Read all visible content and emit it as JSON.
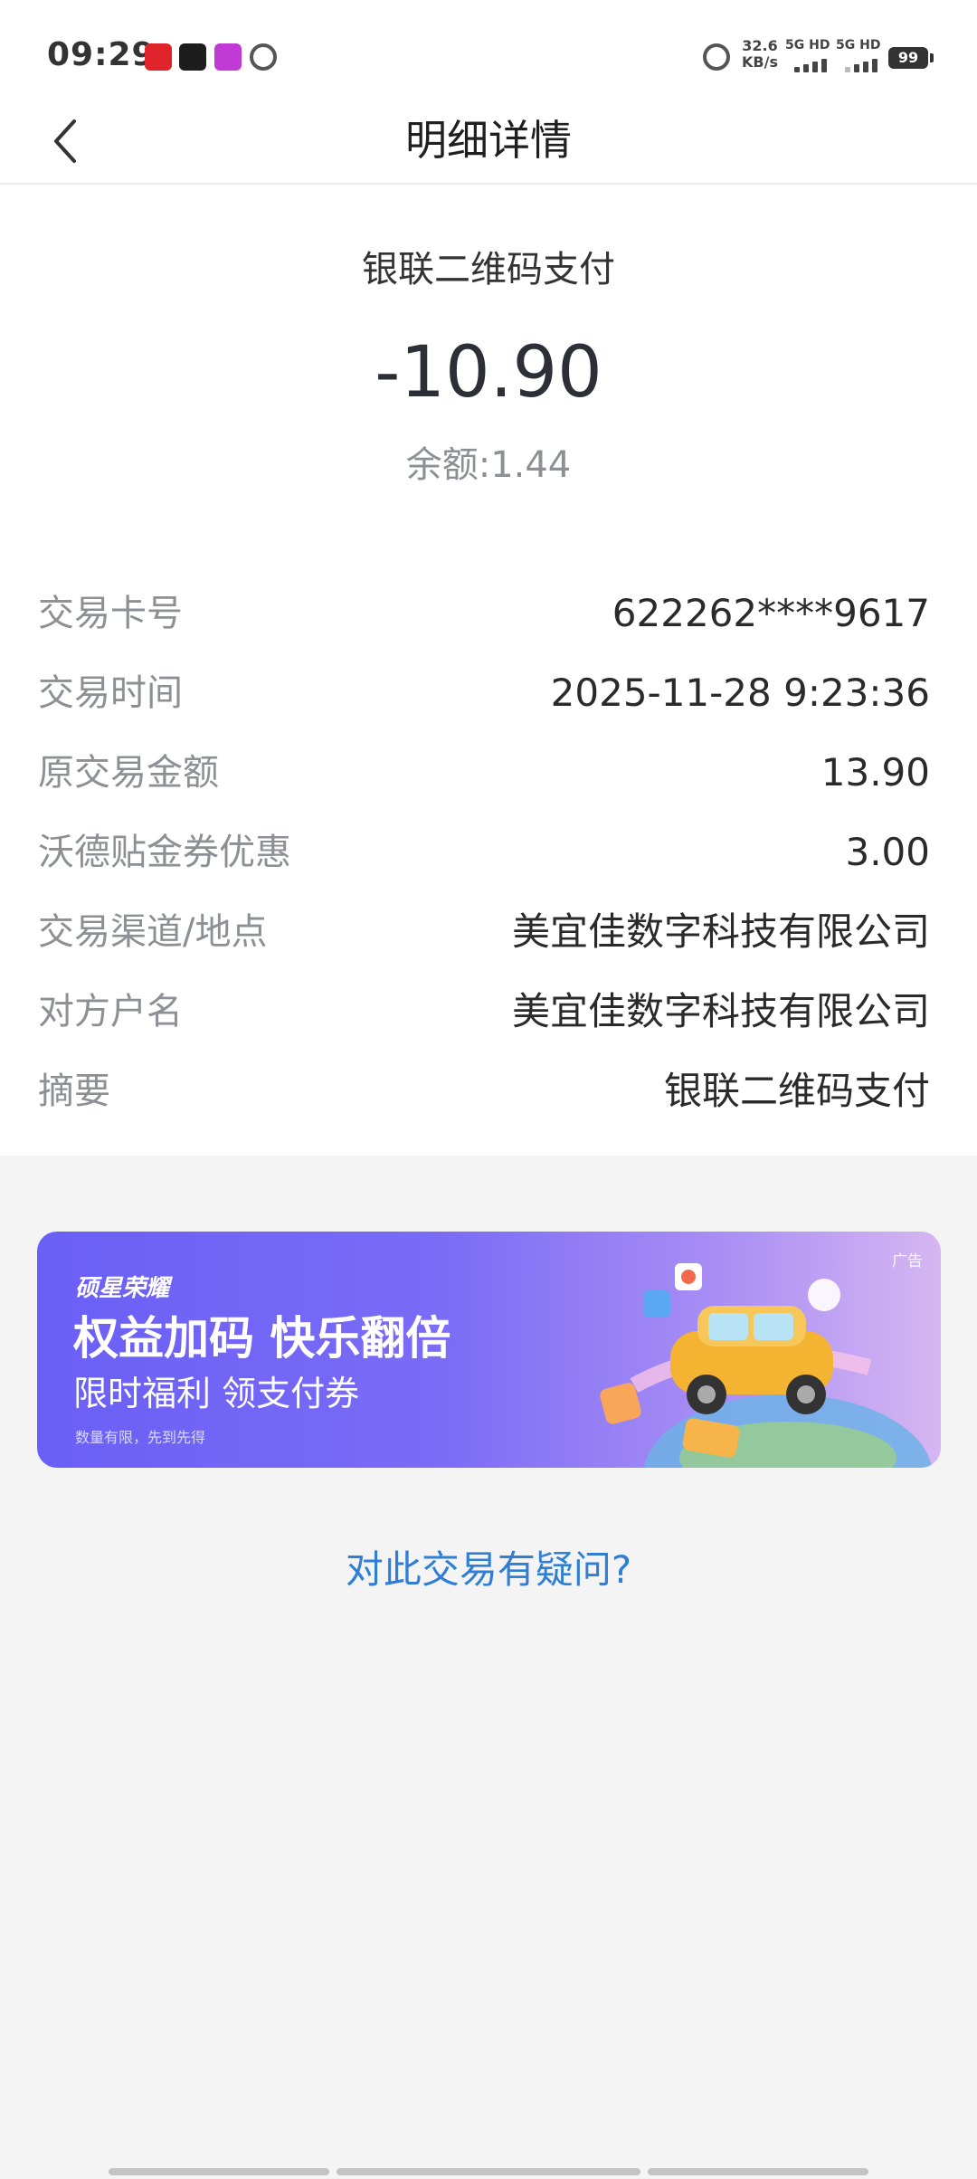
{
  "status_bar": {
    "time": "09:29",
    "net_speed_value": "32.6",
    "net_speed_unit": "KB/s",
    "signal1_label": "5G HD",
    "signal2_label": "5G HD",
    "battery": "99"
  },
  "nav": {
    "title": "明细详情"
  },
  "summary": {
    "type": "银联二维码支付",
    "amount": "-10.90",
    "balance": "余额:1.44"
  },
  "details": [
    {
      "label": "交易卡号",
      "value": "622262****9617"
    },
    {
      "label": "交易时间",
      "value": "2025-11-28 9:23:36"
    },
    {
      "label": "原交易金额",
      "value": "13.90"
    },
    {
      "label": "沃德贴金券优惠",
      "value": "3.00"
    },
    {
      "label": "交易渠道/地点",
      "value": "美宜佳数字科技有限公司"
    },
    {
      "label": "对方户名",
      "value": "美宜佳数字科技有限公司"
    },
    {
      "label": "摘要",
      "value": "银联二维码支付"
    }
  ],
  "ad": {
    "brand": "硕星荣耀",
    "title": "权益加码 快乐翻倍",
    "subtitle": "限时福利 领支付券",
    "note": "数量有限，先到先得",
    "tag": "广告"
  },
  "question_link": "对此交易有疑问?",
  "colors": {
    "accent_link": "#2f7fd6",
    "label_gray": "#8d8f94",
    "ad_purple": "#6a5ff6"
  }
}
